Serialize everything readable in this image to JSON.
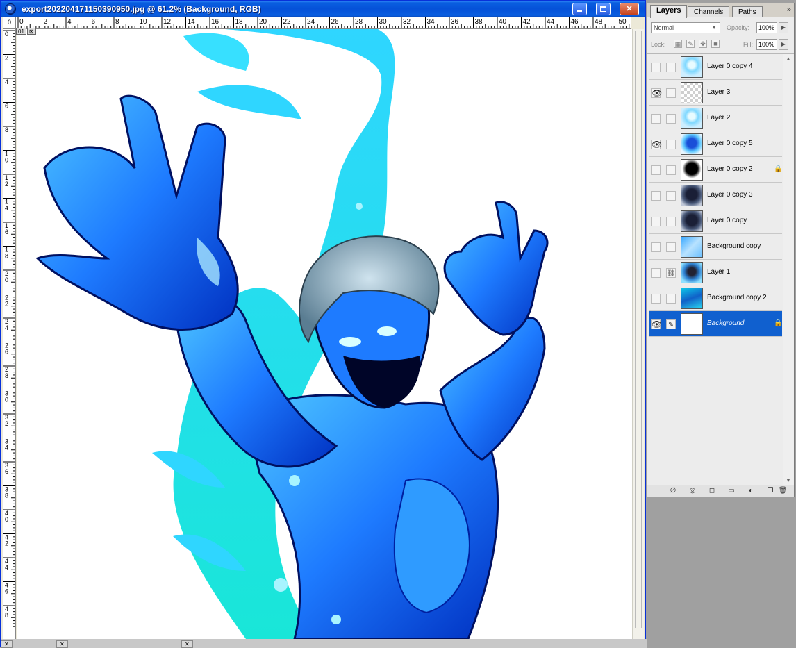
{
  "document": {
    "title": "export202204171150390950.jpg @ 61.2% (Background, RGB)"
  },
  "rulers": {
    "top": [
      "0",
      "2",
      "4",
      "6",
      "8",
      "10",
      "12",
      "14",
      "16",
      "18",
      "20",
      "22",
      "24",
      "26",
      "28",
      "30",
      "32",
      "34",
      "36",
      "38",
      "40",
      "42",
      "44",
      "46",
      "48",
      "50"
    ],
    "left": [
      "0",
      "2",
      "4",
      "6",
      "8",
      "10",
      "12",
      "14",
      "16",
      "18",
      "20",
      "22",
      "24",
      "26",
      "28",
      "30",
      "32",
      "34",
      "36",
      "38",
      "40",
      "42",
      "44",
      "46",
      "48"
    ],
    "corner_label": "0",
    "view_tabs": [
      "01",
      "⊠"
    ]
  },
  "layers_panel": {
    "tabs": [
      "Layers",
      "Channels",
      "Paths"
    ],
    "menu_glyph": "»",
    "blend_mode": "Normal",
    "opacity_label": "Opacity:",
    "opacity_value": "100%",
    "lock_label": "Lock:",
    "fill_label": "Fill:",
    "fill_value": "100%",
    "spin_glyph": "▶",
    "layers": [
      {
        "name": "Layer 0 copy 4",
        "visible": false,
        "linked": "",
        "locked": false,
        "selected": false,
        "thumb": "fig-cyan-light"
      },
      {
        "name": "Layer 3",
        "visible": true,
        "linked": "",
        "locked": false,
        "selected": false,
        "thumb": "transparent"
      },
      {
        "name": "Layer 2",
        "visible": false,
        "linked": "",
        "locked": false,
        "selected": false,
        "thumb": "fig-cyan-light"
      },
      {
        "name": "Layer 0 copy 5",
        "visible": true,
        "linked": "",
        "locked": false,
        "selected": false,
        "thumb": "fig-blue"
      },
      {
        "name": "Layer 0 copy 2",
        "visible": false,
        "linked": "",
        "locked": true,
        "selected": false,
        "thumb": "silhouette"
      },
      {
        "name": "Layer 0 copy 3",
        "visible": false,
        "linked": "",
        "locked": false,
        "selected": false,
        "thumb": "fig-dark"
      },
      {
        "name": "Layer 0 copy",
        "visible": false,
        "linked": "",
        "locked": false,
        "selected": false,
        "thumb": "fig-dark"
      },
      {
        "name": "Background copy",
        "visible": false,
        "linked": "",
        "locked": false,
        "selected": false,
        "thumb": "grad-blue"
      },
      {
        "name": "Layer 1",
        "visible": false,
        "linked": "⛓",
        "locked": false,
        "selected": false,
        "thumb": "fig-water"
      },
      {
        "name": "Background copy 2",
        "visible": false,
        "linked": "",
        "locked": false,
        "selected": false,
        "thumb": "water"
      },
      {
        "name": "Background",
        "visible": true,
        "linked": "✎",
        "locked": true,
        "selected": true,
        "thumb": "white"
      }
    ],
    "eye_glyph": "👁",
    "lock_glyph": "🔒",
    "footer_icons": [
      {
        "name": "link-layers-icon",
        "glyph": "∅"
      },
      {
        "name": "layer-style-icon",
        "glyph": "◎"
      },
      {
        "name": "layer-mask-icon",
        "glyph": "◻"
      },
      {
        "name": "new-group-icon",
        "glyph": "▭"
      },
      {
        "name": "adjustment-layer-icon",
        "glyph": "◐"
      },
      {
        "name": "new-layer-icon",
        "glyph": "❐"
      },
      {
        "name": "delete-layer-icon",
        "glyph": "🗑"
      }
    ]
  },
  "colors": {
    "titlebar": "#0551d8",
    "selection": "#1060cf",
    "figure_blue": "#1e7bff",
    "figure_cyan": "#2fd6ff",
    "figure_dark": "#001a9a",
    "fin_teal": "#19e6d8"
  }
}
